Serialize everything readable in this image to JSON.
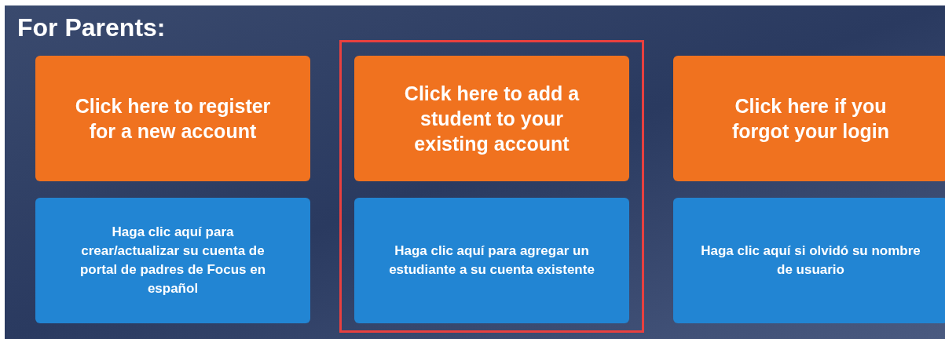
{
  "heading": "For Parents:",
  "columns": [
    {
      "highlighted": false,
      "english_button": "Click here to register for a new account",
      "spanish_button": "Haga clic aquí para crear/actualizar su cuenta de portal de padres de Focus en español"
    },
    {
      "highlighted": true,
      "english_button": "Click here to add a student to your existing account",
      "spanish_button": "Haga clic aquí para agregar un estudiante a su cuenta existente"
    },
    {
      "highlighted": false,
      "english_button": "Click here if you forgot your login",
      "spanish_button": "Haga clic aquí si olvidó su nombre de usuario"
    }
  ]
}
